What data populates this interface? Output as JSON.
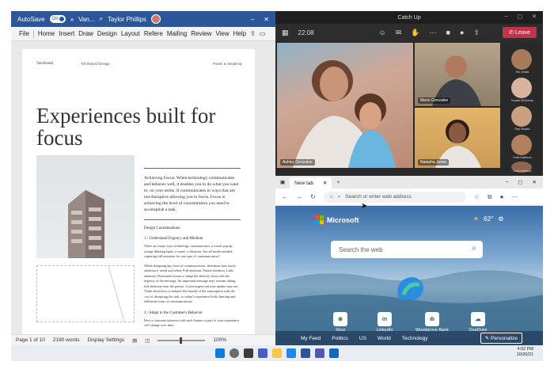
{
  "word": {
    "autosave": "AutoSave",
    "toggle": "On",
    "doc_short": "Van...",
    "user": "Taylor Phillips",
    "menu": [
      "File",
      "Home",
      "Insert",
      "Draw",
      "Design",
      "Layout",
      "Refere",
      "Mailing",
      "Review",
      "View",
      "Help"
    ],
    "page": {
      "brand": "VanArsdel",
      "brand2": "Tilt Shared Design",
      "brand3": "Power & Simplicity",
      "heading": "Experiences built for focus",
      "lead": "Achieving Focus: When technology communicates and behaves well, it enables you to do what you want to, on your terms. It communicates in ways that are not disruptive allowing you to focus. Focus is achieving the level of concentration you need to accomplish a task.",
      "sub1": "Design Considerations",
      "sub2": "1 / Understand Urgency and Medium",
      "p1": "There are many ways technology communicates: a visual pop up, orange blinking light, a sound, a vibration. Are all modes needed, capturing full attention for one type of communication?",
      "p2": "When designing any form of communication, determine how much attention it needs and when. Full attention, Partial attention, Little attention. Determine assure to adapt the delivery form with the urgency of the message. An important message may warrant taking full attention from the person. A non-urgent software update may not. Think about how to balance the benefit of the interruption with the cost of disrupting the task, so today's experience looks limiting and deliberate form of communications.",
      "sub3": "2 / Adapt to the Customer's Behavior",
      "p3": "How a customer interacts with each feature or part of your experience will change over time."
    },
    "status": {
      "page": "Page 1 of 10",
      "words": "2190 words",
      "display": "Display Settings",
      "zoom": "100%"
    }
  },
  "teams": {
    "title": "Catch Up",
    "time": "22:08",
    "leave": "Leave",
    "tiles": [
      "Ashley Gonzales",
      "Mario Gonzales",
      "Natasha Jones"
    ],
    "sidebar": [
      "Eric Ishida",
      "Krystal McKinney",
      "Ray Tanaka",
      "Celia Harbison",
      "Cora Harbison"
    ]
  },
  "edge": {
    "tab": "New tab",
    "address_placeholder": "Search or enter web address",
    "brand": "Microsoft",
    "temp": "62°",
    "search_placeholder": "Search the web",
    "quick_links": [
      "Xbox",
      "LinkedIn",
      "Woodgrove Bank",
      "OneDrive"
    ],
    "feed": [
      "My Feed",
      "Politics",
      "US",
      "World",
      "Technology"
    ],
    "personalize": "Personalize"
  },
  "taskbar": {
    "time": "4:02 PM",
    "date": "10/20/21"
  }
}
